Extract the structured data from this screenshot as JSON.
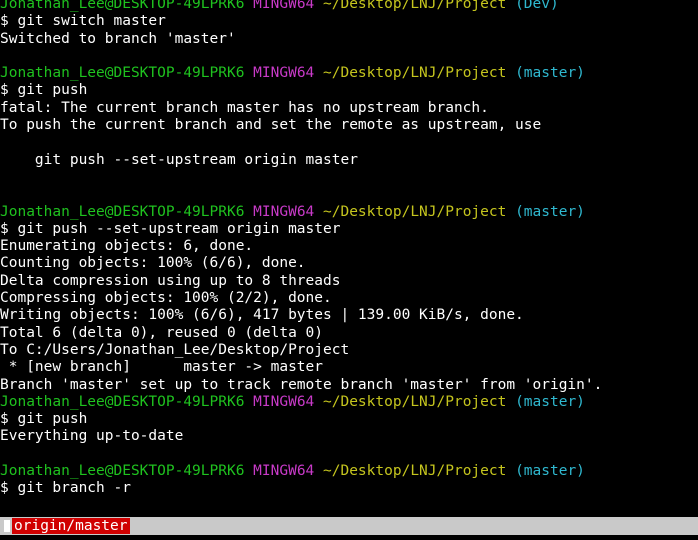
{
  "prompt": {
    "user_host": "Jonathan_Lee@DESKTOP-49LPRK6",
    "env": "MINGW64",
    "path": "~/Desktop/LNJ/Project"
  },
  "lines": [
    {
      "type": "prompt",
      "branch": "(Dev)"
    },
    {
      "type": "text",
      "text": "$ git switch master"
    },
    {
      "type": "text",
      "text": "Switched to branch 'master'"
    },
    {
      "type": "blank",
      "text": ""
    },
    {
      "type": "prompt",
      "branch": "(master)"
    },
    {
      "type": "text",
      "text": "$ git push"
    },
    {
      "type": "text",
      "text": "fatal: The current branch master has no upstream branch."
    },
    {
      "type": "text",
      "text": "To push the current branch and set the remote as upstream, use"
    },
    {
      "type": "blank",
      "text": ""
    },
    {
      "type": "text",
      "text": "    git push --set-upstream origin master"
    },
    {
      "type": "blank",
      "text": ""
    },
    {
      "type": "blank",
      "text": ""
    },
    {
      "type": "prompt",
      "branch": "(master)"
    },
    {
      "type": "text",
      "text": "$ git push --set-upstream origin master"
    },
    {
      "type": "text",
      "text": "Enumerating objects: 6, done."
    },
    {
      "type": "text",
      "text": "Counting objects: 100% (6/6), done."
    },
    {
      "type": "text",
      "text": "Delta compression using up to 8 threads"
    },
    {
      "type": "text",
      "text": "Compressing objects: 100% (2/2), done."
    },
    {
      "type": "text",
      "text": "Writing objects: 100% (6/6), 417 bytes | 139.00 KiB/s, done."
    },
    {
      "type": "text",
      "text": "Total 6 (delta 0), reused 0 (delta 0)"
    },
    {
      "type": "text",
      "text": "To C:/Users/Jonathan_Lee/Desktop/Project"
    },
    {
      "type": "text",
      "text": " * [new branch]      master -> master"
    },
    {
      "type": "text",
      "text": "Branch 'master' set up to track remote branch 'master' from 'origin'."
    },
    {
      "type": "prompt",
      "branch": "(master)"
    },
    {
      "type": "text",
      "text": "$ git push"
    },
    {
      "type": "text",
      "text": "Everything up-to-date"
    },
    {
      "type": "blank",
      "text": ""
    },
    {
      "type": "prompt",
      "branch": "(master)"
    },
    {
      "type": "text",
      "text": "$ git branch -r"
    }
  ],
  "pager": {
    "highlight_text": "origin/master"
  },
  "colors": {
    "background": "#000000",
    "user_host": "#1fc21f",
    "env": "#c83ac8",
    "path": "#c5c51e",
    "branch": "#2fb8cf",
    "pager_bar": "#c9c9c9",
    "pager_highlight": "#d00000"
  }
}
